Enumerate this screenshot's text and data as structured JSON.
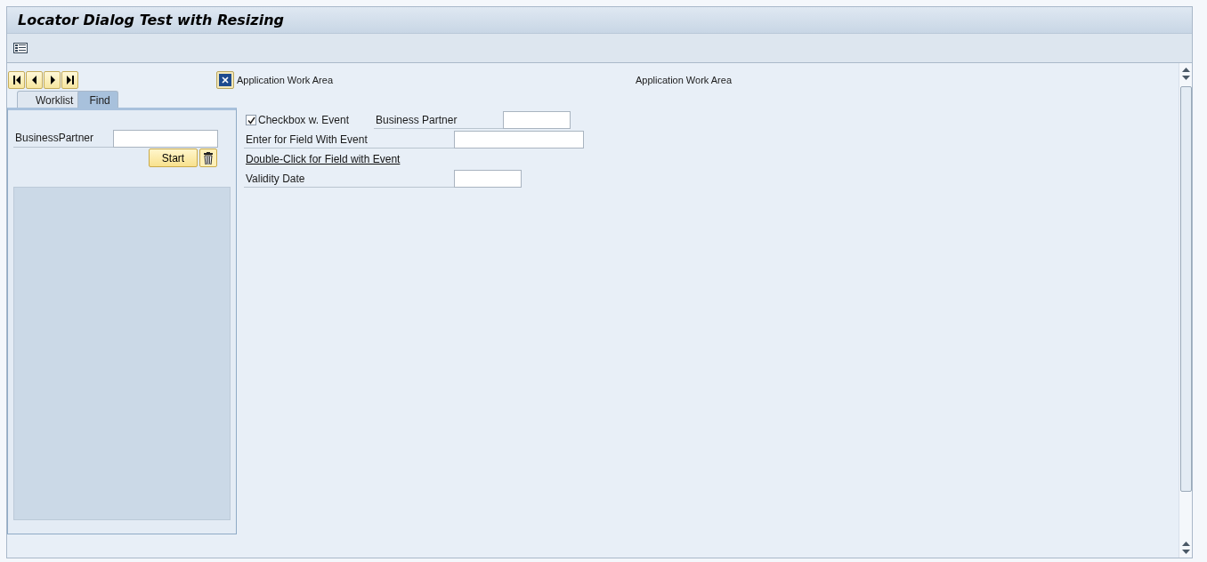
{
  "window": {
    "title": "Locator Dialog Test with Resizing"
  },
  "locator": {
    "tabs": [
      {
        "label": "Worklist",
        "selected": false
      },
      {
        "label": "Find",
        "selected": true
      }
    ],
    "search_label": "BusinessPartner",
    "start_button": "Start"
  },
  "work_area": {
    "toggle_label": "Application Work Area",
    "header_right": "Application Work Area",
    "checkbox": {
      "label": "Checkbox w. Event",
      "checked": true
    },
    "business_partner_label": "Business Partner",
    "enter_field_label": "Enter for Field With Event",
    "double_click_link": "Double-Click for Field with Event",
    "validity_date_label": "Validity Date"
  }
}
